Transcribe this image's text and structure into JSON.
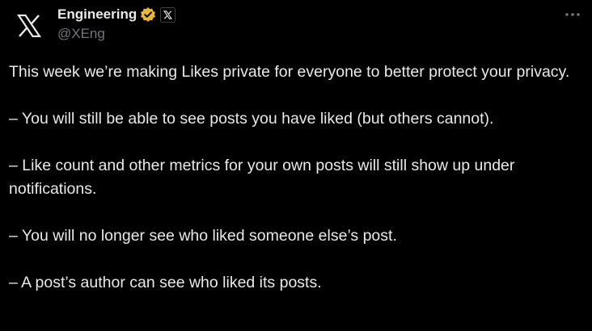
{
  "account": {
    "display_name": "Engineering",
    "handle": "@XEng",
    "avatar_icon": "x-logo-icon",
    "verified_badge_icon": "verified-gold-badge-icon",
    "affiliate_badge_icon": "x-affiliate-badge-icon",
    "badge_color": "#e8b631"
  },
  "menu": {
    "more_icon": "more-options-icon"
  },
  "post": {
    "paragraphs": [
      "This week we’re making Likes private for everyone to better protect your privacy.",
      "– You will still be able to see posts you have liked (but others cannot).",
      "– Like count and other metrics for your own posts will still show up under notifications.",
      "– You will no longer see who liked someone else’s post.",
      "– A post’s author can see who liked its posts."
    ]
  }
}
